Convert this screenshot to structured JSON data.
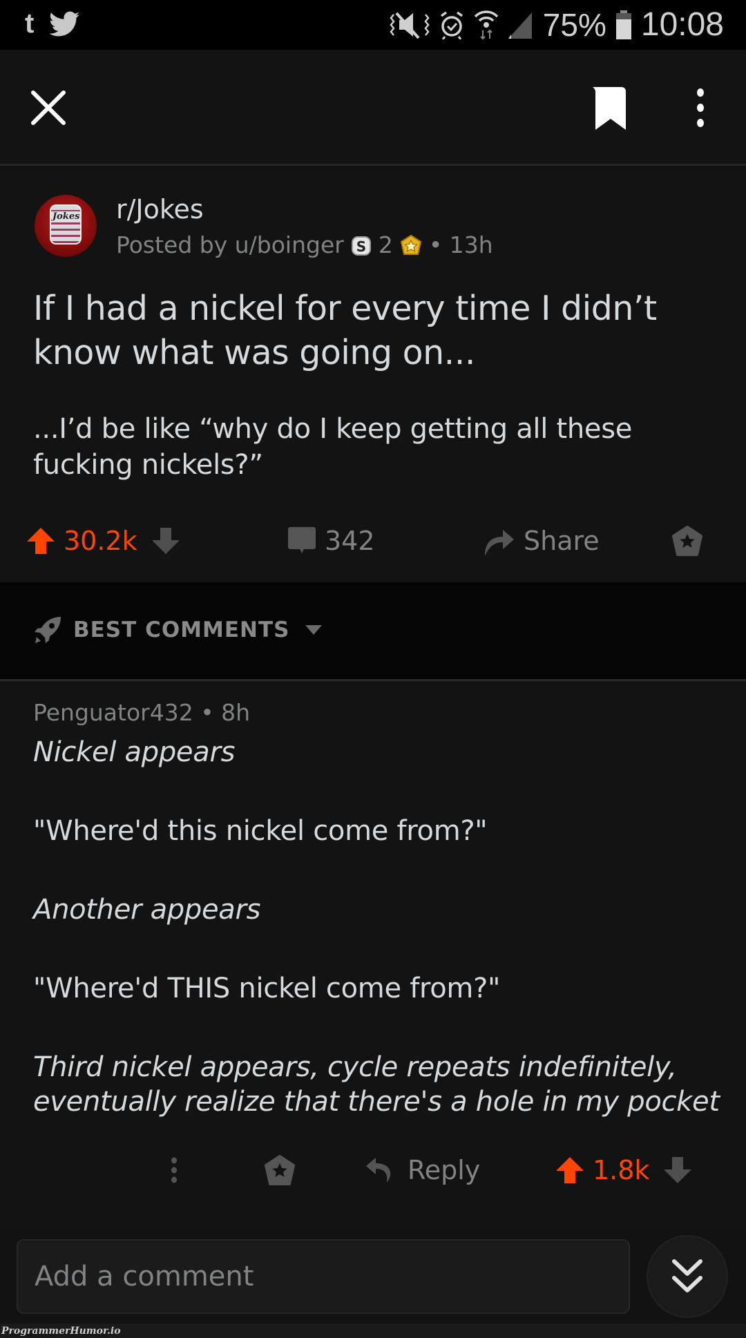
{
  "status_bar": {
    "notification_icons": [
      "tumblr-icon",
      "twitter-icon"
    ],
    "tumblr_glyph": "t",
    "system_icons": [
      "vibrate-mute-icon",
      "alarm-icon",
      "wifi-icon",
      "cell-signal-icon",
      "battery-icon"
    ],
    "battery_percent": "75%",
    "time": "10:08"
  },
  "top_bar": {
    "close_icon": "close-icon",
    "bookmark_icon": "bookmark-icon",
    "more_icon": "more-vertical-icon"
  },
  "post": {
    "subreddit": "r/Jokes",
    "avatar_label": "Jokes",
    "posted_by": "Posted by u/boinger",
    "awards": [
      {
        "icon": "silver-award-icon",
        "count": "2"
      },
      {
        "icon": "gold-award-icon",
        "count": ""
      }
    ],
    "age": "• 13h",
    "title": "If I had a nickel for every time I didn’t know what was going on...",
    "body": "...I’d be like “why do I keep getting all these fucking nickels?”",
    "score": "30.2k",
    "comment_count": "342",
    "share_label": "Share",
    "colors": {
      "upvote": "#ff4500",
      "muted": "#818384",
      "text": "#d7dadc"
    }
  },
  "sort": {
    "label": "BEST COMMENTS",
    "icon": "rocket-icon"
  },
  "comment": {
    "author": "Penguator432",
    "age": "8h",
    "meta": "Penguator432 • 8h",
    "paragraphs": [
      {
        "text": "Nickel appears",
        "italic": true
      },
      {
        "text": "\"Where'd this nickel come from?\"",
        "italic": false
      },
      {
        "text": "Another appears",
        "italic": true
      },
      {
        "text": "\"Where'd THIS nickel come from?\"",
        "italic": false
      },
      {
        "text": "Third nickel appears, cycle repeats indefinitely, eventually realize that there's a hole in my pocket",
        "italic": true
      }
    ],
    "reply_label": "Reply",
    "score": "1.8k"
  },
  "composer": {
    "placeholder": "Add a comment"
  },
  "watermark": "ProgrammerHumor.io"
}
